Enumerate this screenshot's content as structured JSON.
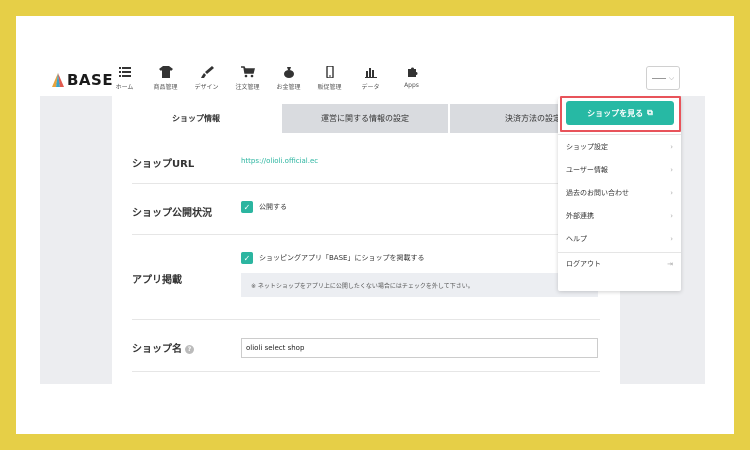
{
  "brand": {
    "logo_text": "BASE"
  },
  "nav": {
    "items": [
      {
        "label": "ホーム",
        "icon": "list-icon"
      },
      {
        "label": "商品管理",
        "icon": "shirt-icon"
      },
      {
        "label": "デザイン",
        "icon": "brush-icon"
      },
      {
        "label": "注文管理",
        "icon": "cart-icon"
      },
      {
        "label": "お金管理",
        "icon": "money-bag-icon"
      },
      {
        "label": "販促管理",
        "icon": "phone-icon"
      },
      {
        "label": "データ",
        "icon": "bar-chart-icon"
      },
      {
        "label": "Apps",
        "icon": "puzzle-icon"
      }
    ]
  },
  "tabs": [
    {
      "label": "ショップ情報",
      "active": true
    },
    {
      "label": "運営に関する情報の設定",
      "active": false
    },
    {
      "label": "決済方法の設定",
      "active": false
    }
  ],
  "form": {
    "shop_url_label": "ショップURL",
    "shop_url_value": "https://olioli.official.ec",
    "shop_status_label": "ショップ公開状況",
    "shop_status_check": "公開する",
    "app_label": "アプリ掲載",
    "app_check": "ショッピングアプリ「BASE」にショップを掲載する",
    "app_note": "※ ネットショップをアプリ上に公開したくない場合にはチェックを外して下さい。",
    "shop_name_label": "ショップ名",
    "shop_name_value": "olioli select shop",
    "help_glyph": "?"
  },
  "dropdown": {
    "view_shop_label": "ショップを見る",
    "items": [
      {
        "label": "ショップ設定"
      },
      {
        "label": "ユーザー情報"
      },
      {
        "label": "過去のお問い合わせ"
      },
      {
        "label": "外部連携"
      },
      {
        "label": "ヘルプ"
      }
    ],
    "logout_label": "ログアウト"
  },
  "colors": {
    "accent": "#27b9a4",
    "highlight": "#e8535a",
    "background_frame": "#e6cf47"
  }
}
